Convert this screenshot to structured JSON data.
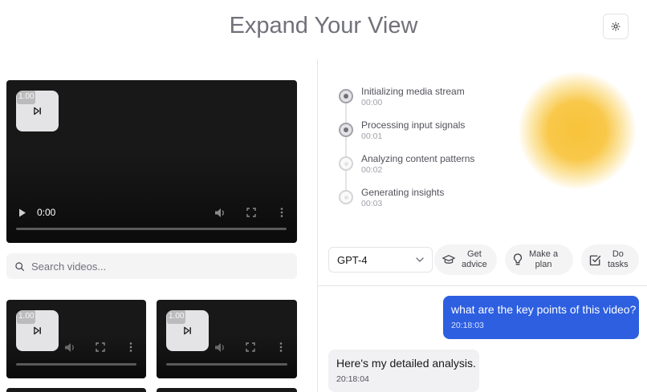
{
  "header": {
    "title": "Expand Your View",
    "theme_toggle_icon": "sun-icon"
  },
  "main_video": {
    "speed": "1.00",
    "current_time": "0:00",
    "skip_icon": "skip-forward-icon"
  },
  "search": {
    "placeholder": "Search videos...",
    "value": ""
  },
  "thumbnail_videos": [
    {
      "speed": "1.00"
    },
    {
      "speed": "1.00"
    }
  ],
  "timeline": {
    "steps": [
      {
        "label": "Initializing media stream",
        "time": "00:00",
        "state": "done"
      },
      {
        "label": "Processing input signals",
        "time": "00:01",
        "state": "done"
      },
      {
        "label": "Analyzing content patterns",
        "time": "00:02",
        "state": "pending"
      },
      {
        "label": "Generating insights",
        "time": "00:03",
        "state": "pending"
      }
    ]
  },
  "model_select": {
    "selected": "GPT-4"
  },
  "quick_actions": [
    {
      "line1": "Get",
      "line2": "advice",
      "icon": "graduation-cap-icon"
    },
    {
      "line1": "Make a",
      "line2": "plan",
      "icon": "lightbulb-icon"
    },
    {
      "line1": "Do",
      "line2": "tasks",
      "icon": "checkbox-icon"
    }
  ],
  "chat": {
    "messages": [
      {
        "role": "user",
        "text": "what are the key points of this video?",
        "time": "20:18:03"
      },
      {
        "role": "assistant",
        "text": "Here's my detailed analysis.",
        "time": "20:18:04"
      }
    ]
  },
  "colors": {
    "user_bubble": "#2d5fe0",
    "sun": "#f8c33a"
  }
}
